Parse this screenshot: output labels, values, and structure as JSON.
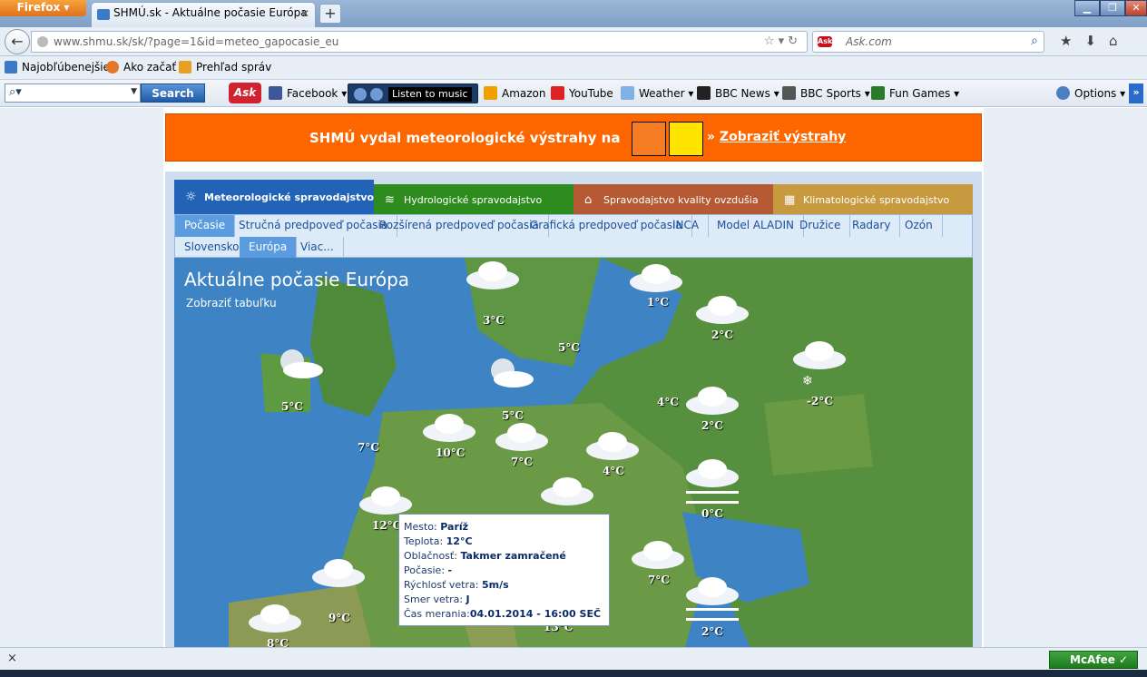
{
  "browser": {
    "app_button": "Firefox",
    "tab_title": "SHMÚ.sk - Aktuálne počasie Európa",
    "new_tab": "+",
    "url": "www.shmu.sk/sk/?page=1&id=meteo_gapocasie_eu",
    "search_placeholder": "Ask.com"
  },
  "bookmarks": [
    {
      "label": "Najobľúbenejšie",
      "color": "#3a78c9"
    },
    {
      "label": "Ako začať",
      "color": "#e4762a"
    },
    {
      "label": "Prehľad správ",
      "color": "#e8a020"
    }
  ],
  "toolbar": {
    "search_button": "Search",
    "ask_logo": "Ask",
    "music_label": "Listen to music",
    "items": [
      {
        "label": "Facebook",
        "color": "#3b5998"
      },
      {
        "label": "Amazon",
        "color": "#f0a000"
      },
      {
        "label": "YouTube",
        "color": "#d22"
      },
      {
        "label": "Weather",
        "color": "#7fb0e8"
      },
      {
        "label": "BBC News",
        "color": "#222"
      },
      {
        "label": "BBC Sports",
        "color": "#555"
      },
      {
        "label": "Fun Games",
        "color": "#2b7a2b"
      },
      {
        "label": "Options",
        "color": "#4a7fc1"
      }
    ]
  },
  "alert": {
    "text": "SHMÚ vydal meteorologické výstrahy na",
    "link_prefix": "»",
    "link": "Zobraziť výstrahy"
  },
  "sections": [
    {
      "label": "Meteorologické spravodajstvo",
      "color": "#2263b8"
    },
    {
      "label": "Hydrologické spravodajstvo",
      "color": "#2e8c1e"
    },
    {
      "label": "Spravodajstvo kvality ovzdušia",
      "color": "#b65a36"
    },
    {
      "label": "Klimatologické spravodajstvo",
      "color": "#c79a40"
    }
  ],
  "subnav_row1": [
    "Počasie",
    "Stručná predpoveď počasia",
    "Rozšírená predpoveď počasia",
    "Grafická predpoveď počasia",
    "INCA",
    "Model ALADIN",
    "Družice",
    "Radary",
    "Ozón"
  ],
  "subnav_row2": [
    "Slovensko",
    "Európa",
    "Viac..."
  ],
  "map": {
    "title": "Aktuálne počasie Európa",
    "subtitle": "Zobraziť tabuľku",
    "temps": [
      "3°C",
      "1°C",
      "2°C",
      "5°C",
      "5°C",
      "-2°C",
      "4°C",
      "2°C",
      "7°C",
      "10°C",
      "5°C",
      "7°C",
      "4°C",
      "0°C",
      "12°C",
      "7°C",
      "2°C",
      "9°C",
      "13°C",
      "8°C"
    ]
  },
  "tooltip": {
    "city_label": "Mesto:",
    "city": "Paríž",
    "temp_label": "Teplota:",
    "temp": "12°C",
    "cloud_label": "Oblačnosť:",
    "cloud": "Takmer zamračené",
    "weather_label": "Počasie:",
    "weather": "-",
    "wind_label": "Rýchlosť vetra:",
    "wind": "5m/s",
    "dir_label": "Smer vetra:",
    "dir": "J",
    "time_label": "Čas merania:",
    "time": "04.01.2014 - 16:00 SEČ"
  },
  "status": {
    "close": "×",
    "mcafee": "McAfee"
  }
}
